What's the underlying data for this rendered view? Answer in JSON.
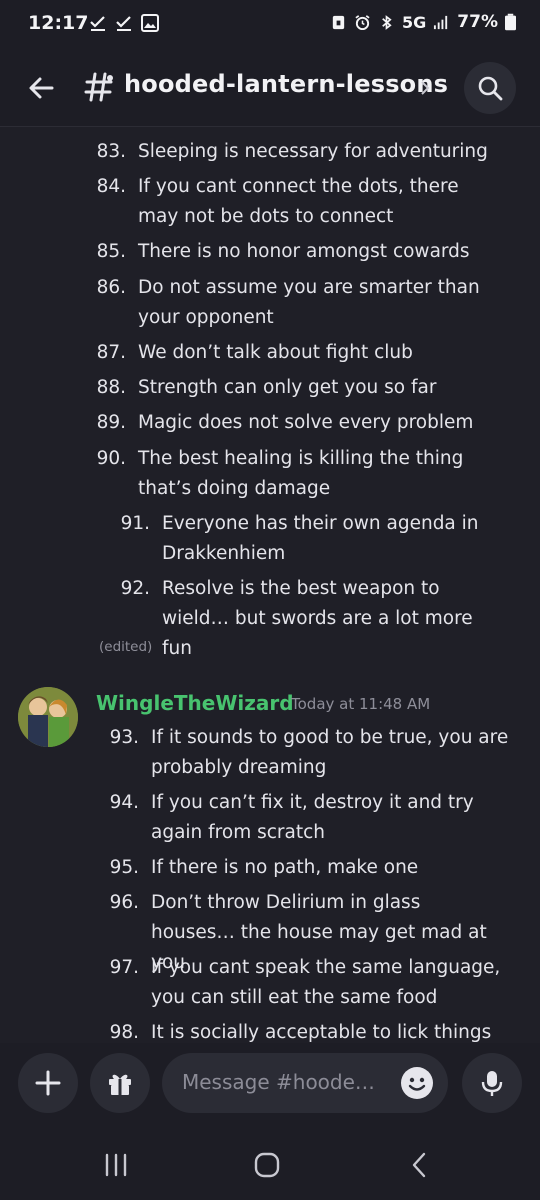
{
  "status_bar": {
    "time": "12:17",
    "network": "5G",
    "battery": "77%"
  },
  "header": {
    "channel_name": "hooded-lantern-lessons"
  },
  "messages": {
    "first_block": [
      {
        "num": "83.",
        "text": "Sleeping is necessary for adventuring"
      },
      {
        "num": "84.",
        "text": "If you cant connect the dots, there may not be dots to connect"
      },
      {
        "num": "85.",
        "text": "There is no honor amongst cowards"
      },
      {
        "num": "86.",
        "text": "Do not assume you are smarter than your opponent"
      },
      {
        "num": "87.",
        "text": "We don’t talk about fight club"
      },
      {
        "num": "88.",
        "text": "Strength can only get you so far"
      },
      {
        "num": "89.",
        "text": "Magic does not solve every problem"
      },
      {
        "num": "90.",
        "text": "The best healing is killing the thing that’s doing damage"
      },
      {
        "num": "91.",
        "text": "Everyone has their own agenda in Drakkenhiem"
      },
      {
        "num": "92.",
        "text": "Resolve is the best weapon to wield… but swords are a lot more fun"
      }
    ],
    "edited_label": "(edited)",
    "second_message": {
      "author": "WingleTheWizard",
      "timestamp": "Today at 11:48 AM",
      "author_color": "#48c36f",
      "items": [
        {
          "num": "93.",
          "text": "If it sounds to good to be true, you are probably dreaming"
        },
        {
          "num": "94.",
          "text": "If you can’t fix it, destroy it and try again from scratch"
        },
        {
          "num": "95.",
          "text": "If there is no path, make one"
        },
        {
          "num": "96.",
          "text": "Don’t throw Delirium in glass houses… the house may get mad at you"
        },
        {
          "num": "97.",
          "text": "If you cant speak the same language, you can still eat the same food"
        },
        {
          "num": "98.",
          "text": "It is socially acceptable to lick things"
        }
      ]
    }
  },
  "composer": {
    "placeholder": "Message #hoode…"
  }
}
